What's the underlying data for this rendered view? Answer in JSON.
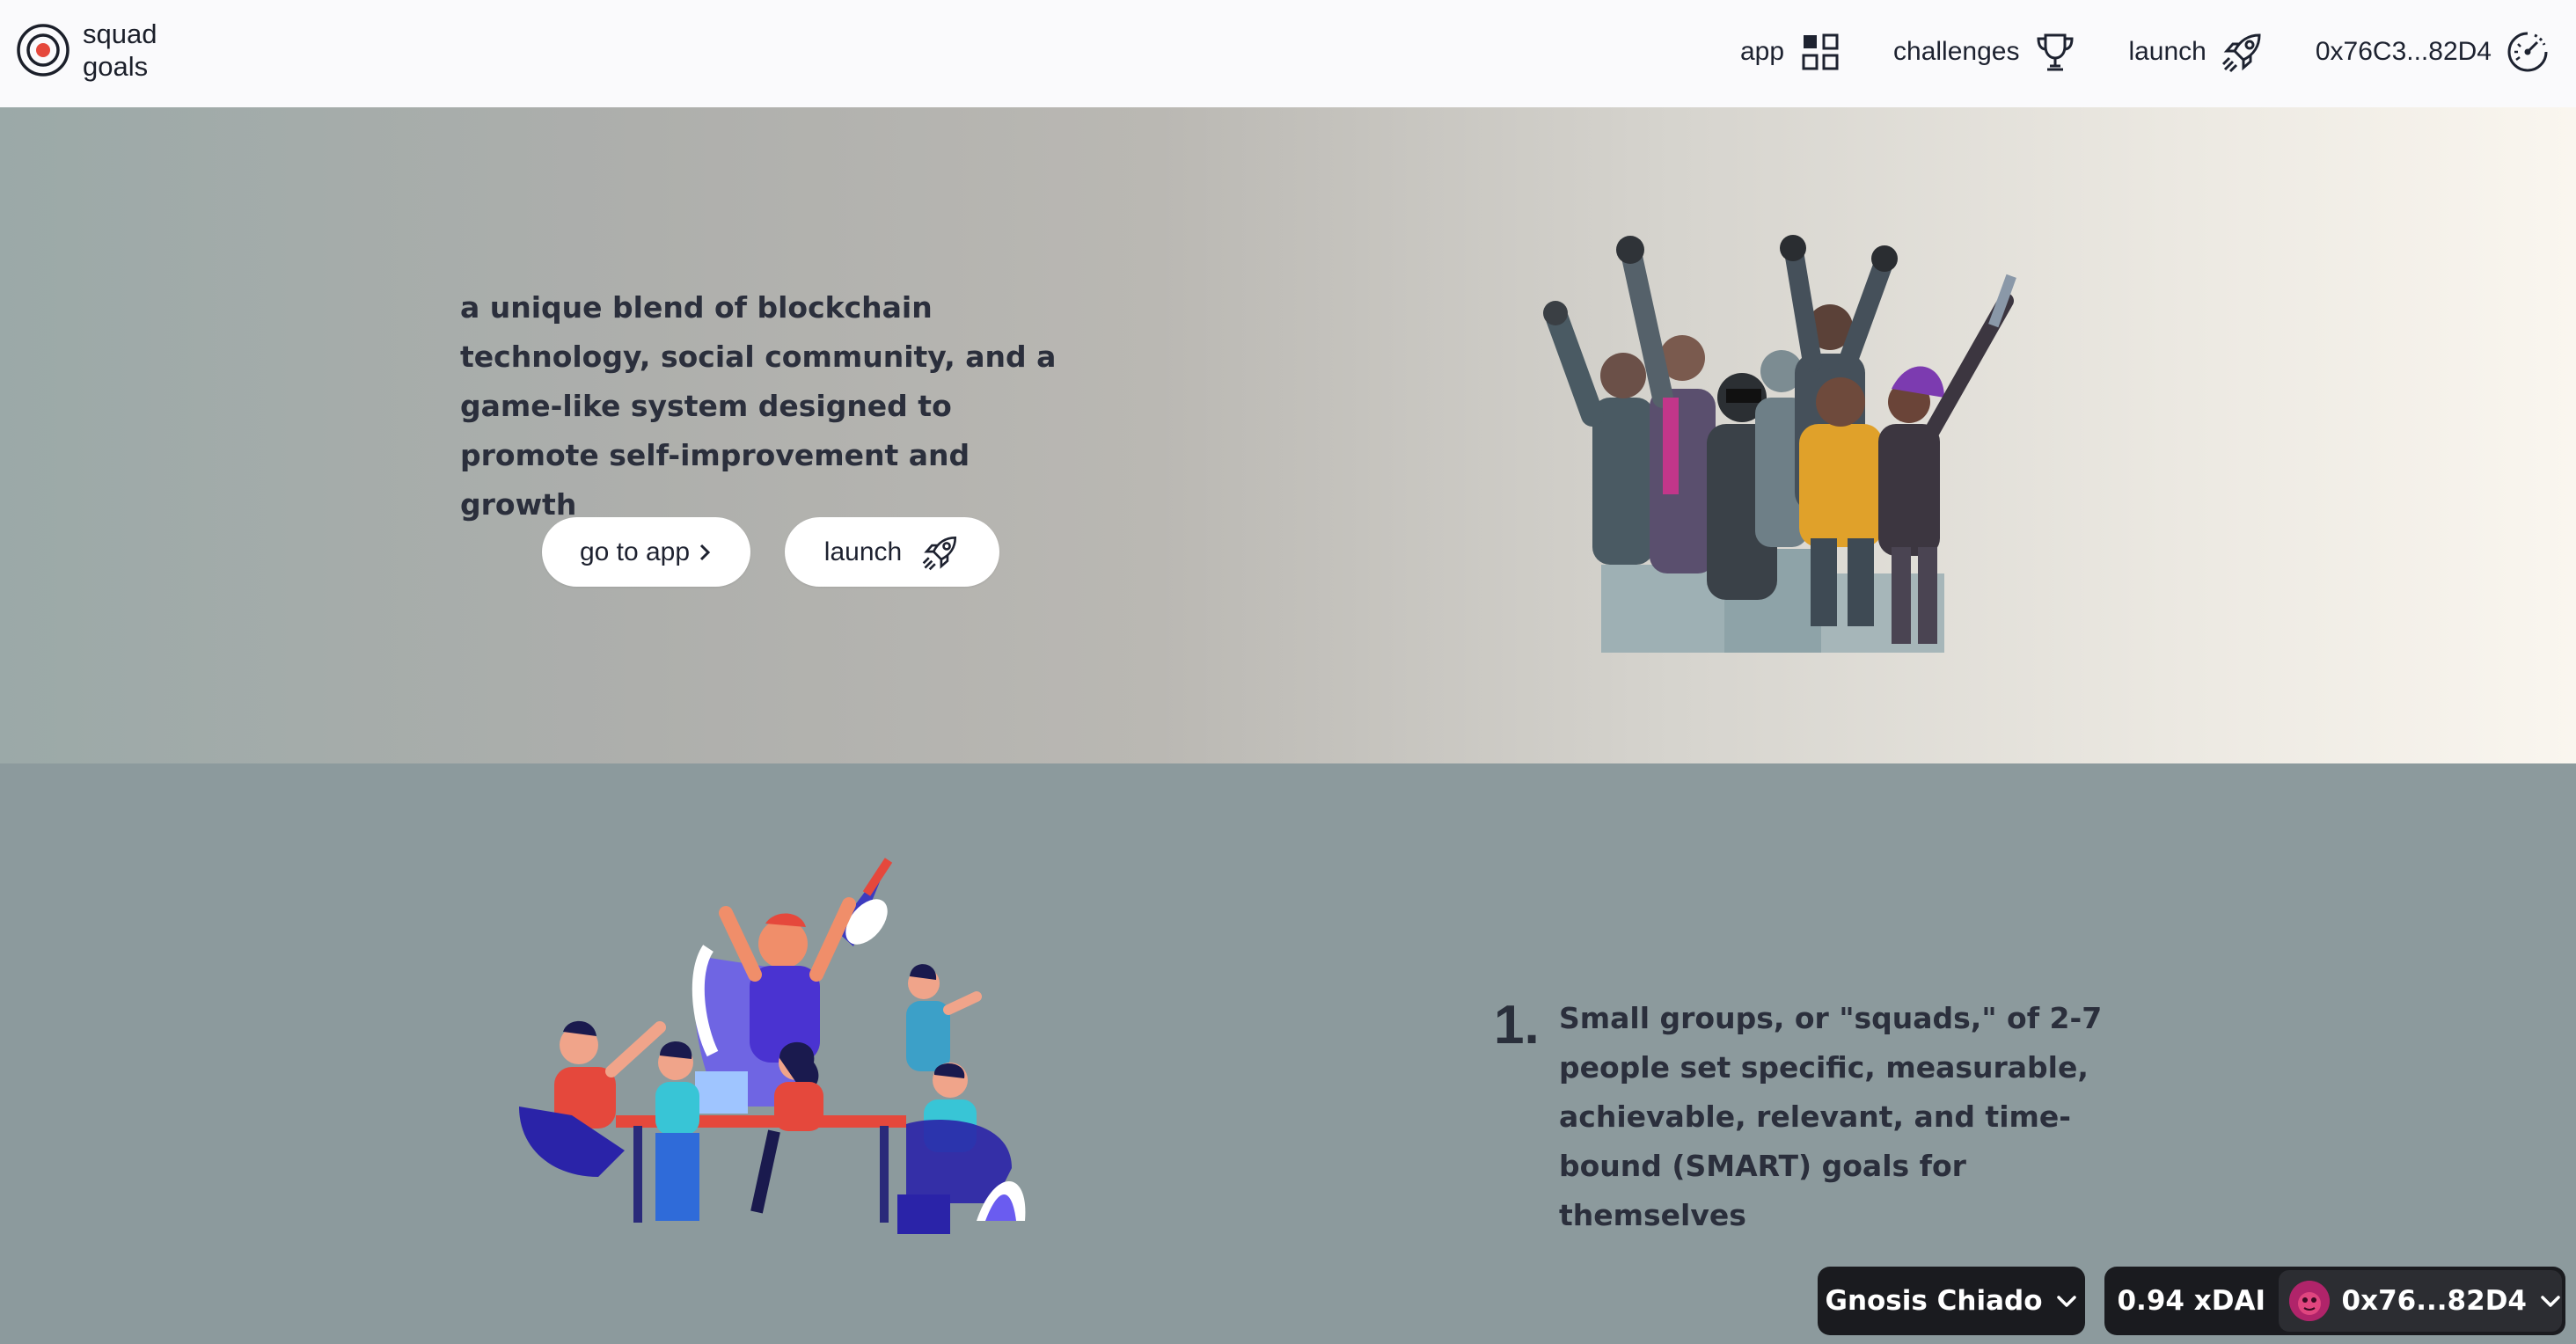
{
  "brand": {
    "line1": "squad",
    "line2": "goals",
    "icon": "target-icon"
  },
  "nav": {
    "items": [
      {
        "label": "app",
        "icon": "grid-icon"
      },
      {
        "label": "challenges",
        "icon": "trophy-icon"
      },
      {
        "label": "launch",
        "icon": "rocket-icon"
      },
      {
        "label": "0x76C3...82D4",
        "icon": "dashboard-gauge-icon"
      }
    ]
  },
  "hero": {
    "text": "a unique blend of blockchain technology, social community, and a game-like system designed to promote self-improvement and growth",
    "go_to_app_label": "go to app",
    "launch_label": "launch"
  },
  "steps": [
    {
      "number": "1.",
      "text": "Small groups, or \"squads,\" of 2-7 people set specific, measurable, achievable, relevant, and time-bound (SMART) goals for themselves"
    }
  ],
  "wallet": {
    "chain": "Gnosis Chiado",
    "balance": "0.94 xDAI",
    "account": "0x76...82D4"
  },
  "colors": {
    "header_bg": "#fafafc",
    "section_bg": "#8c9a9d",
    "wallet_bg": "#1a1b1f",
    "accent_red": "#e5483c"
  }
}
